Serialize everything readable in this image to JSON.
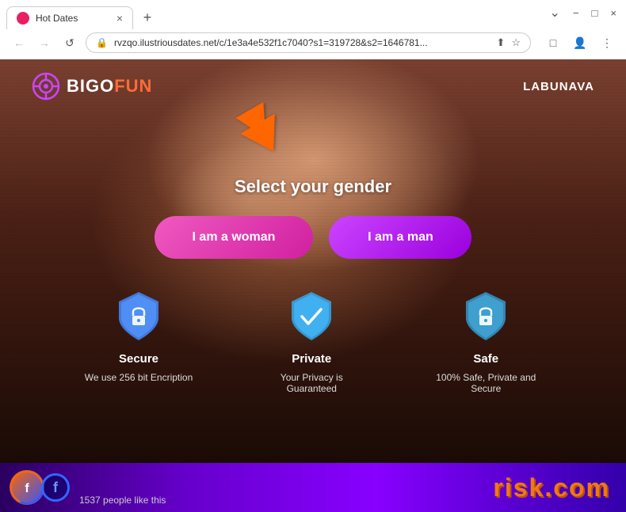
{
  "browser": {
    "tab_title": "Hot Dates",
    "tab_close": "×",
    "tab_new": "+",
    "url": "rvzqo.ilustriousdates.net/c/1e3a4e532f1c7040?s1=319728&s2=1646781...",
    "nav_back": "←",
    "nav_forward": "→",
    "nav_reload": "↺",
    "win_minimize": "−",
    "win_maximize": "□",
    "win_close": "×"
  },
  "site": {
    "logo_bigo": "BIGO",
    "logo_fun": "FUN",
    "nav_link": "LABUNAVA"
  },
  "main": {
    "gender_title": "Select your gender",
    "btn_woman": "I am a woman",
    "btn_man": "I am a man"
  },
  "features": [
    {
      "name": "Secure",
      "desc": "We use 256 bit Encription",
      "shield_color": "#5599ff"
    },
    {
      "name": "Private",
      "desc": "Your Privacy is Guaranteed",
      "shield_color": "#44aaff"
    },
    {
      "name": "Safe",
      "desc": "100% Safe, Private and Secure",
      "shield_color": "#55aaff"
    }
  ],
  "bottom": {
    "likes": "1537 people like this",
    "risk": "risk",
    "dotcom": ".com"
  }
}
